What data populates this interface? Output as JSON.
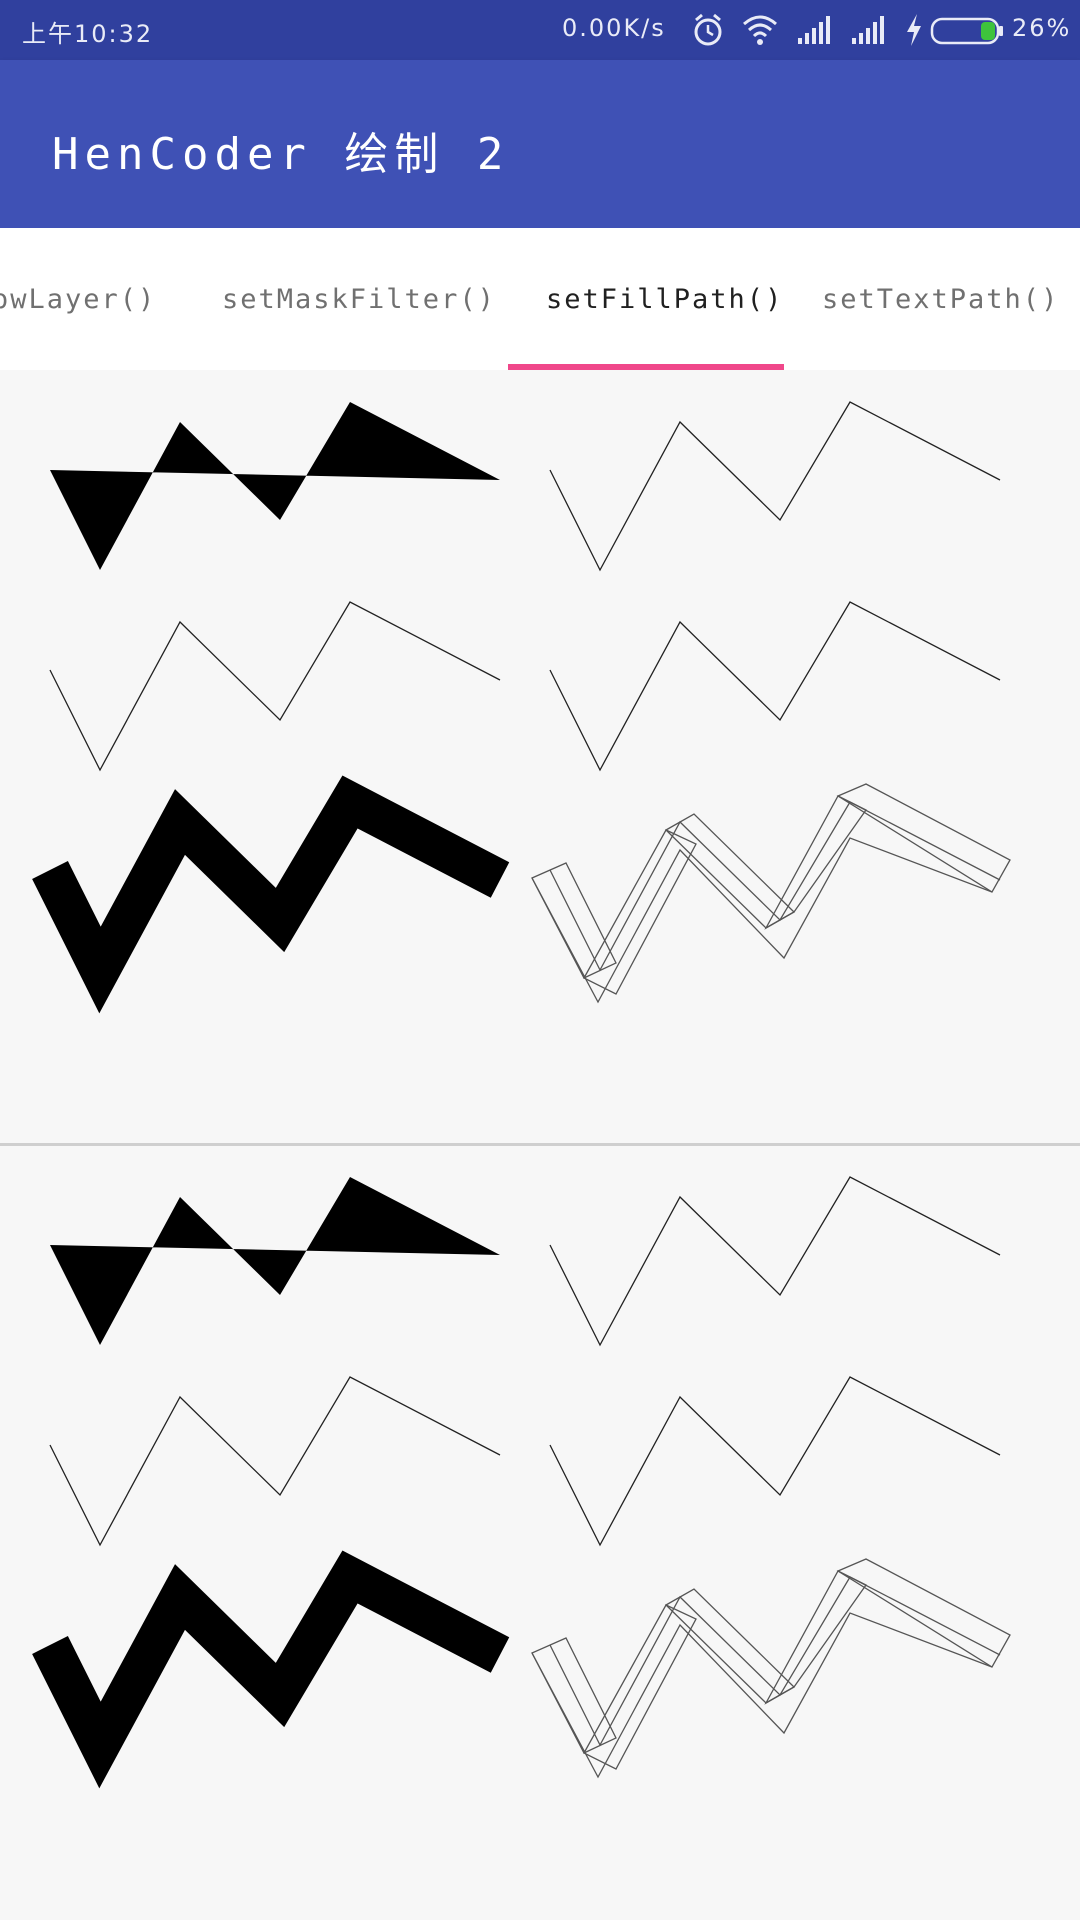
{
  "status_bar": {
    "time": "上午10:32",
    "network_speed": "0.00K/s",
    "battery_percent": "26%",
    "icons": [
      "alarm-icon",
      "wifi-icon",
      "signal-icon",
      "signal-icon",
      "charging-icon",
      "battery-icon"
    ]
  },
  "app_bar": {
    "title": "HenCoder 绘制 2"
  },
  "tabs": {
    "items": [
      {
        "label": "owLayer()",
        "active": false
      },
      {
        "label": "setMaskFilter()",
        "active": false
      },
      {
        "label": "setFillPath()",
        "active": true
      },
      {
        "label": "setTextPath()",
        "active": false
      }
    ],
    "indicator_color": "#f0478a"
  },
  "colors": {
    "status_bar": "#30409e",
    "app_bar": "#3f51b5",
    "background": "#f7f7f7",
    "stroke": "#000000"
  }
}
